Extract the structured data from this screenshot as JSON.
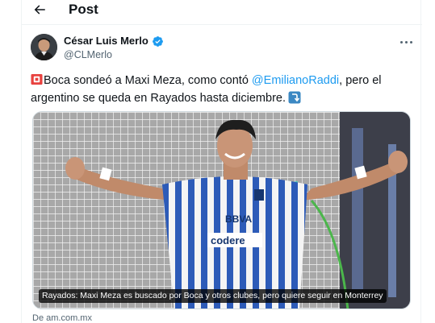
{
  "header": {
    "back_icon": "arrow-left-icon",
    "title": "Post"
  },
  "author": {
    "name": "César Luis Merlo",
    "handle": "@CLMerlo",
    "verified": true,
    "verified_color": "#1d9bf0"
  },
  "tweet": {
    "part1": "Boca sondeó a Maxi Meza, como contó ",
    "mention": "@EmilianoRaddi",
    "part2": ", pero el argentino se queda en Rayados hasta diciembre.",
    "leading_emoji": "police-siren-icon",
    "trailing_emoji": "arrow-curving-down-icon"
  },
  "media": {
    "caption": "Rayados: Maxi Meza es buscado por Boca y otros clubes, pero quiere seguir en Monterrey",
    "jersey_sponsor": "BBVA",
    "jersey_sponsor2": "codere"
  },
  "card": {
    "source": "De am.com.mx"
  },
  "colors": {
    "accent": "#1d9bf0",
    "text": "#0f1419",
    "secondary": "#536471"
  }
}
